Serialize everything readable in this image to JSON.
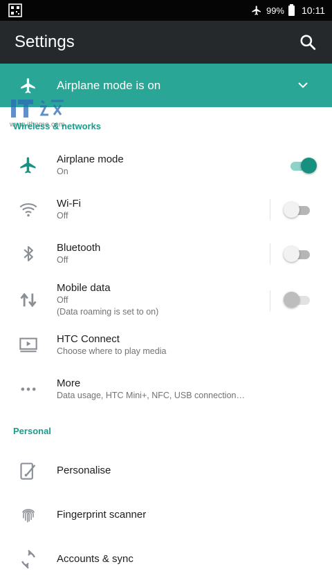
{
  "status_bar": {
    "battery_percent": "99%",
    "time": "10:11"
  },
  "app_bar": {
    "title": "Settings"
  },
  "airplane_banner": {
    "text": "Airplane mode is on"
  },
  "watermark": {
    "text": "www.ithome.com"
  },
  "sections": {
    "wireless": {
      "header": "Wireless & networks",
      "items": [
        {
          "label": "Airplane mode",
          "sub": "On",
          "icon": "airplane-icon",
          "toggle": "on"
        },
        {
          "label": "Wi-Fi",
          "sub": "Off",
          "icon": "wifi-icon",
          "toggle": "off"
        },
        {
          "label": "Bluetooth",
          "sub": "Off",
          "icon": "bluetooth-icon",
          "toggle": "off"
        },
        {
          "label": "Mobile data",
          "sub": "Off",
          "sub2": "(Data roaming is set to on)",
          "icon": "mobile-data-icon",
          "toggle": "off-disabled"
        },
        {
          "label": "HTC Connect",
          "sub": "Choose where to play media",
          "icon": "cast-icon"
        },
        {
          "label": "More",
          "sub": "Data usage, HTC Mini+, NFC, USB connection…",
          "icon": "more-icon"
        }
      ]
    },
    "personal": {
      "header": "Personal",
      "items": [
        {
          "label": "Personalise",
          "icon": "personalise-icon"
        },
        {
          "label": "Fingerprint scanner",
          "icon": "fingerprint-icon"
        },
        {
          "label": "Accounts & sync",
          "icon": "sync-icon"
        }
      ]
    }
  },
  "colors": {
    "accent": "#2aa696",
    "app_bar": "#25292c",
    "status_bar": "#050505",
    "section_header": "#1c9b8a"
  }
}
